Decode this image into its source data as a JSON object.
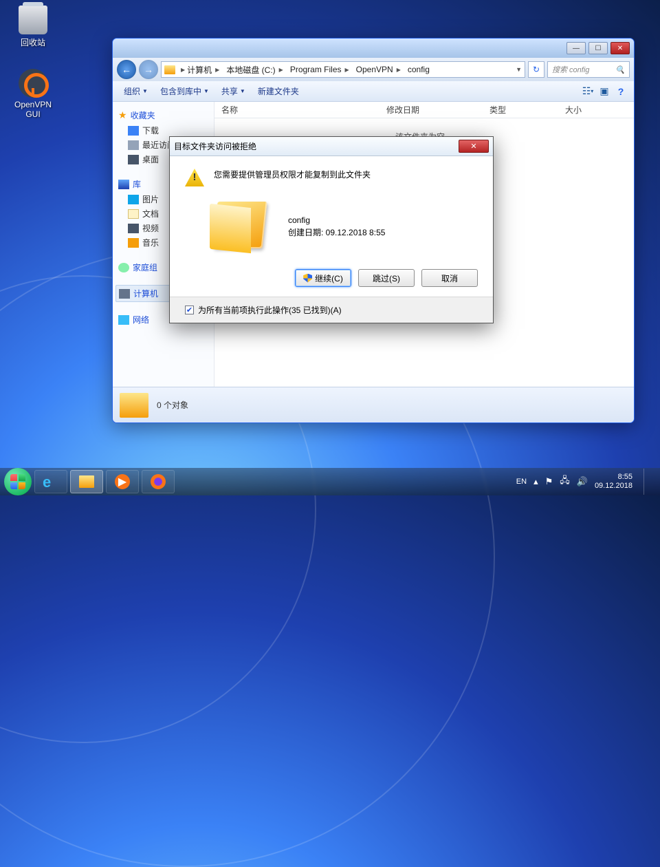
{
  "desktop": {
    "recycle_bin": "回收站",
    "openvpn": "OpenVPN GUI"
  },
  "window": {
    "nav_min": "—",
    "nav_max": "☐",
    "nav_close": "✕",
    "breadcrumb": [
      "计算机",
      "本地磁盘 (C:)",
      "Program Files",
      "OpenVPN",
      "config"
    ],
    "search_placeholder": "搜索 config",
    "toolbar": {
      "organize": "组织",
      "include": "包含到库中",
      "share": "共享",
      "newfolder": "新建文件夹"
    },
    "columns": {
      "name": "名称",
      "modified": "修改日期",
      "type": "类型",
      "size": "大小"
    },
    "empty_msg": "该文件夹为空。",
    "status": "0 个对象",
    "sidebar": {
      "favorites": "收藏夹",
      "downloads": "下载",
      "recent": "最近访问",
      "desktop": "桌面",
      "libraries": "库",
      "pictures": "图片",
      "documents": "文档",
      "videos": "视频",
      "music": "音乐",
      "homegroup": "家庭组",
      "computer": "计算机",
      "network": "网络"
    }
  },
  "dialog": {
    "title": "目标文件夹访问被拒绝",
    "message": "您需要提供管理员权限才能复制到此文件夹",
    "folder_name": "config",
    "created_label": "创建日期: 09.12.2018 8:55",
    "continue": "继续(C)",
    "skip": "跳过(S)",
    "cancel": "取消",
    "apply_all": "为所有当前项执行此操作(35 已找到)(A)"
  },
  "taskbar": {
    "lang": "EN",
    "time": "8:55",
    "date": "09.12.2018"
  }
}
